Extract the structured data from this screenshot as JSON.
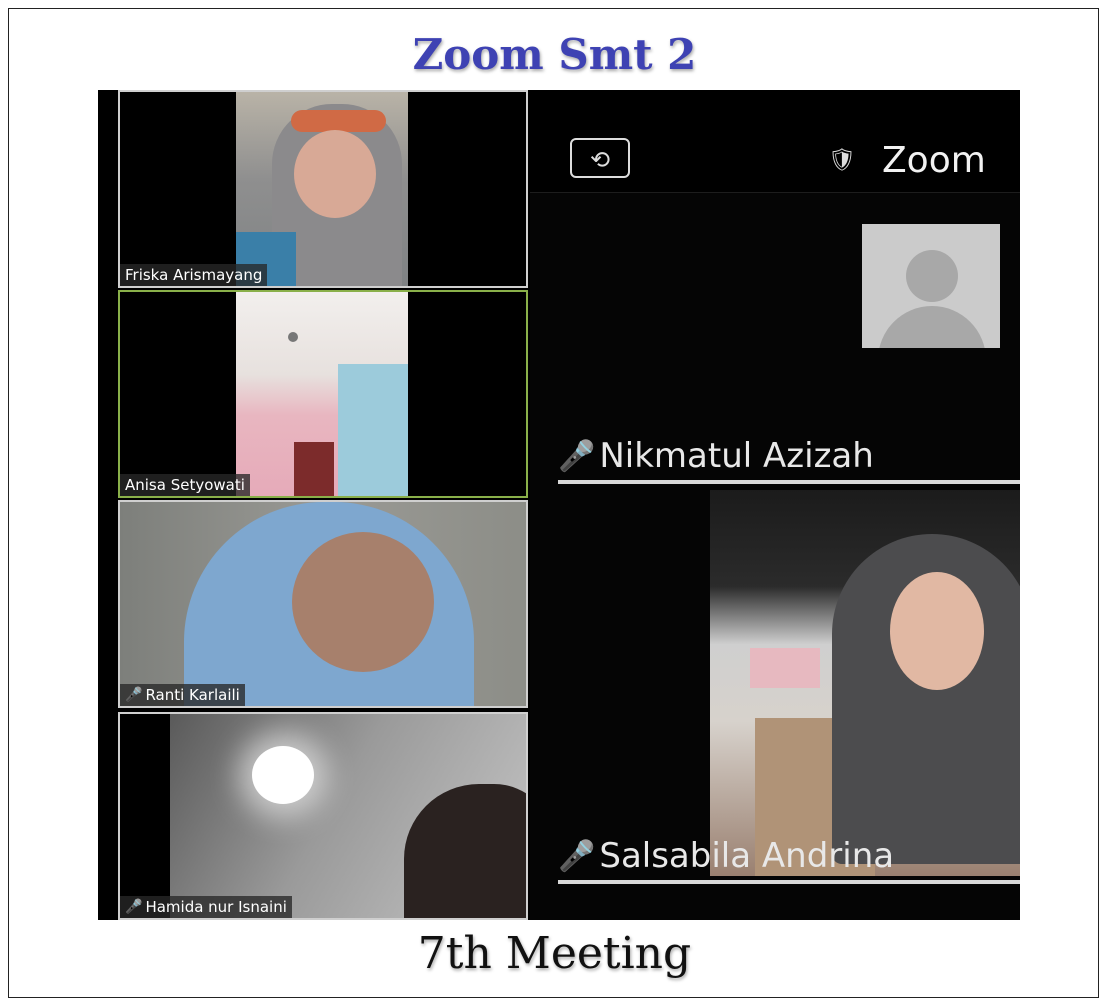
{
  "header": {
    "title": "Zoom Smt 2"
  },
  "footer": {
    "caption": "7th Meeting"
  },
  "gallery": {
    "participants": [
      {
        "name": "Friska Arismayang",
        "muted": false,
        "active": false
      },
      {
        "name": "Anisa Setyowati",
        "muted": false,
        "active": true
      },
      {
        "name": "Ranti Karlaili",
        "muted": true,
        "active": false
      },
      {
        "name": "Hamida nur Isnaini",
        "muted": true,
        "active": false
      }
    ]
  },
  "zoom_app": {
    "title": "Zoom",
    "camera_switch_icon": "camera-switch-icon",
    "security_icon": "shield-icon",
    "participants": [
      {
        "name": "Nikmatul Azizah",
        "muted": true,
        "video": false
      },
      {
        "name": "Salsabila Andrina",
        "muted": true,
        "video": true
      }
    ]
  },
  "icons": {
    "mic_muted": "🎤",
    "camera_switch": "⟲",
    "shield": "🛡"
  },
  "colors": {
    "title": "#3e42b3",
    "active_border": "#8ab04a",
    "muted_mic": "#e23b3b"
  }
}
